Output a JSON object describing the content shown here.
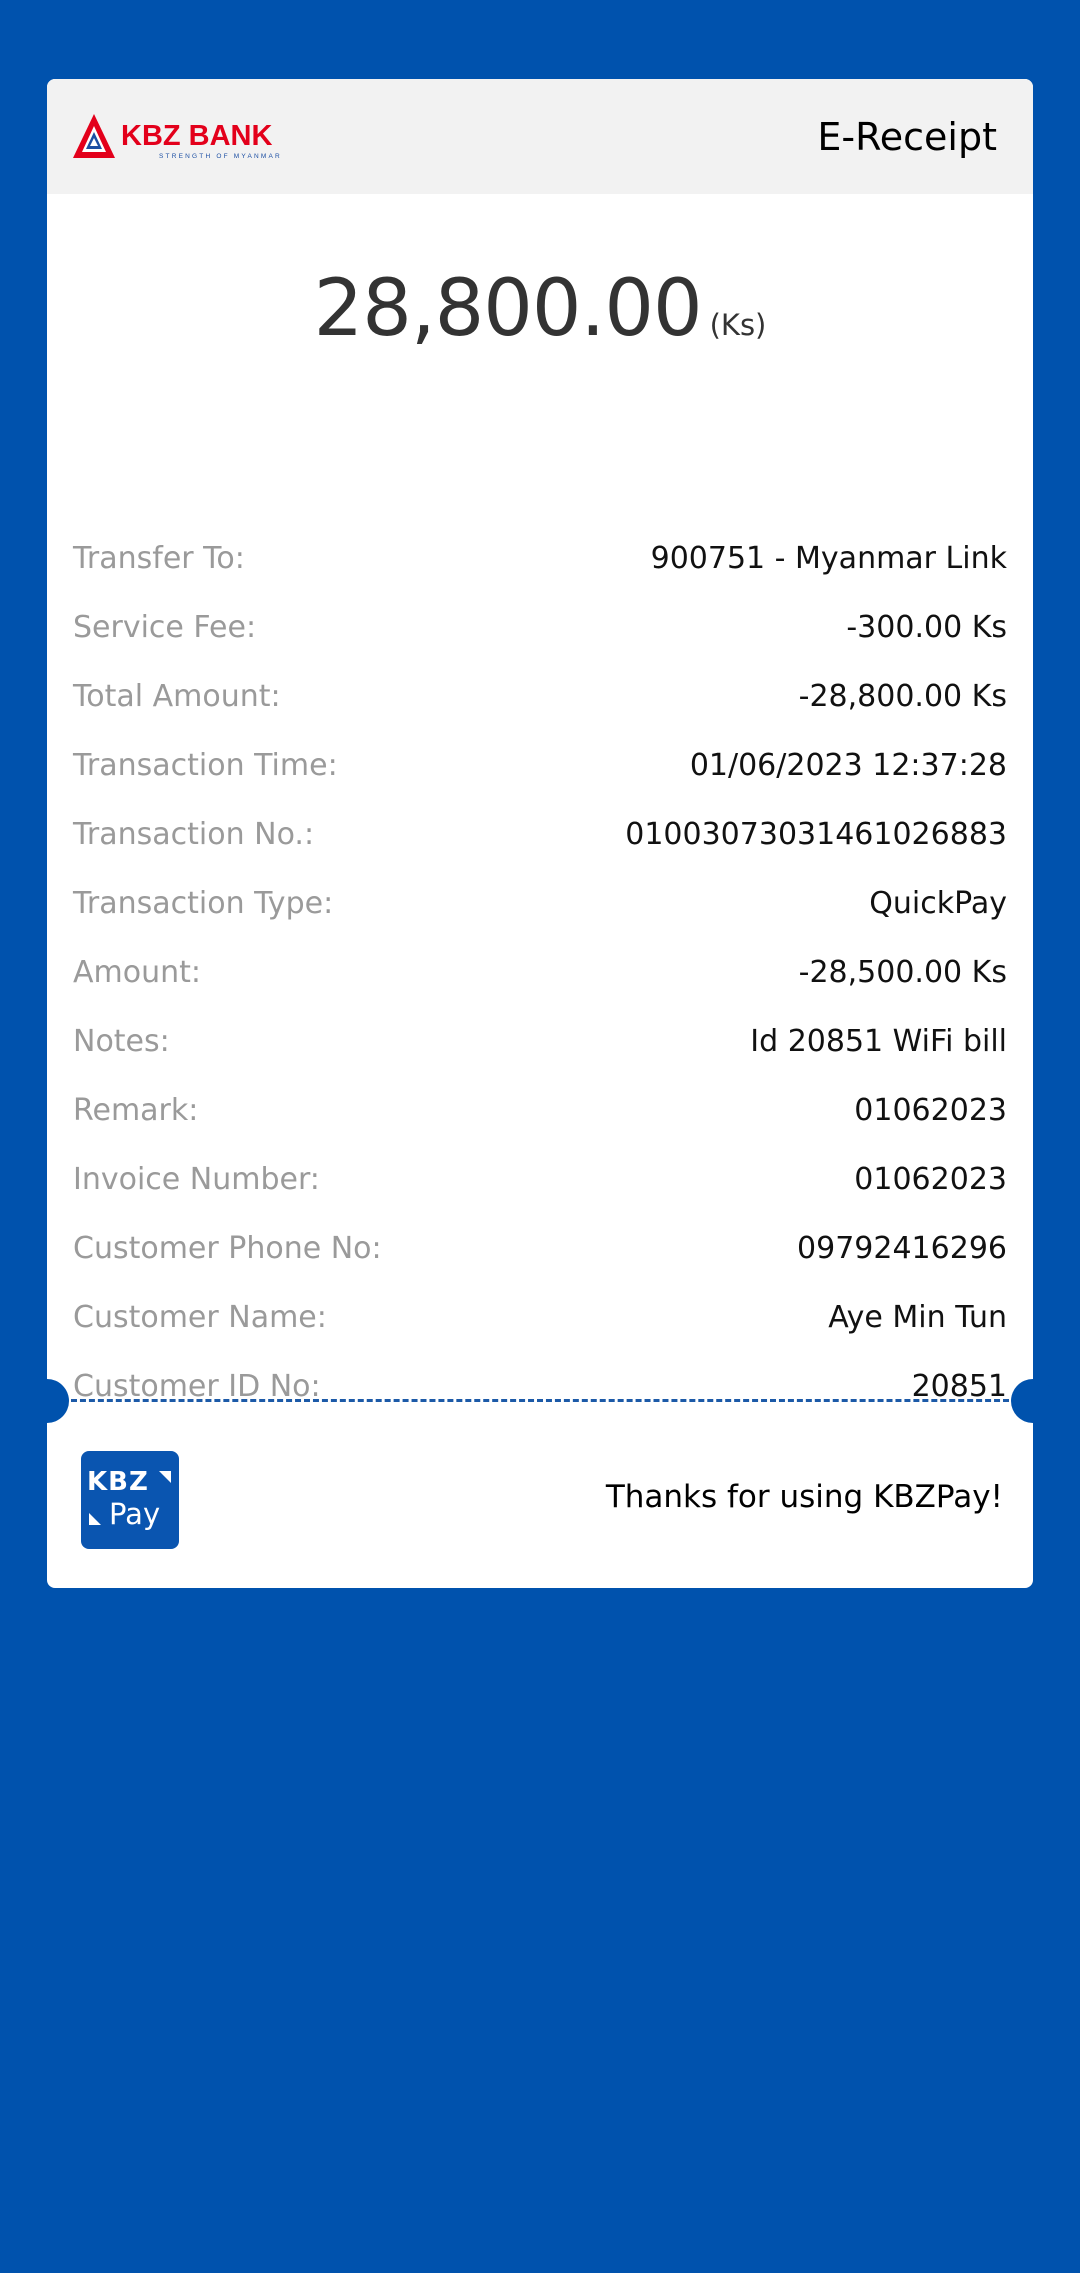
{
  "header": {
    "bank_name": "KBZ BANK",
    "bank_tagline": "STRENGTH OF MYANMAR",
    "title": "E-Receipt"
  },
  "amount": {
    "value": "28,800.00",
    "unit": "(Ks)"
  },
  "details": [
    {
      "label": "Transfer To:",
      "value": "900751 - Myanmar Link"
    },
    {
      "label": "Service Fee:",
      "value": "-300.00 Ks"
    },
    {
      "label": "Total Amount:",
      "value": "-28,800.00 Ks"
    },
    {
      "label": "Transaction Time:",
      "value": "01/06/2023 12:37:28"
    },
    {
      "label": "Transaction No.:",
      "value": "01003073031461026883"
    },
    {
      "label": "Transaction Type:",
      "value": "QuickPay"
    },
    {
      "label": "Amount:",
      "value": "-28,500.00 Ks"
    },
    {
      "label": "Notes:",
      "value": "Id 20851 WiFi bill"
    },
    {
      "label": "Remark:",
      "value": "01062023"
    },
    {
      "label": "Invoice Number:",
      "value": "01062023"
    },
    {
      "label": "Customer Phone No:",
      "value": "09792416296"
    },
    {
      "label": "Customer Name:",
      "value": "Aye Min Tun"
    },
    {
      "label": "Customer ID No:",
      "value": "20851"
    }
  ],
  "footer": {
    "logo_top": "KBZ",
    "logo_bottom": "Pay",
    "thanks": "Thanks for using KBZPay!"
  },
  "colors": {
    "background": "#0052ad",
    "brand_red": "#e3001b",
    "brand_blue": "#0a55b0",
    "label_gray": "#9a9a9a"
  }
}
